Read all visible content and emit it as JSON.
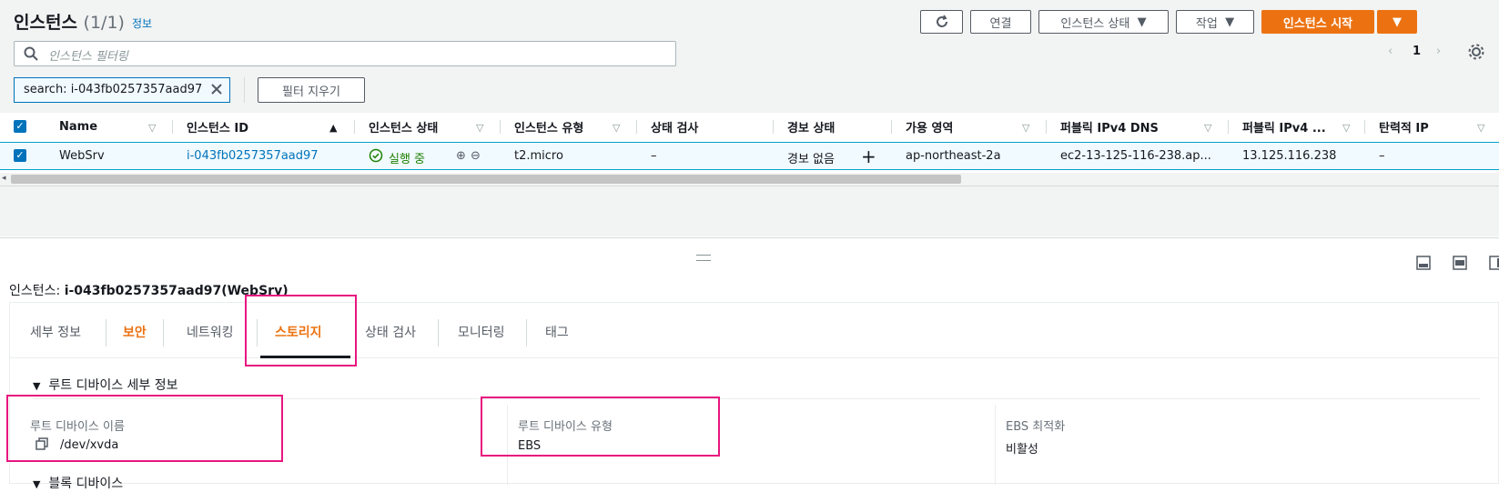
{
  "header": {
    "title": "인스턴스",
    "count": "(1/1)",
    "info_link": "정보",
    "refresh_icon": "refresh-icon",
    "connect_label": "연결",
    "instance_state_label": "인스턴스 상태",
    "actions_label": "작업",
    "launch_label": "인스턴스 시작"
  },
  "search": {
    "placeholder": "인스턴스 필터링"
  },
  "pager": {
    "current_page": "1"
  },
  "filter": {
    "token": "search: i-043fb0257357aad97",
    "clear_label": "필터 지우기"
  },
  "table": {
    "columns": [
      "Name",
      "인스턴스 ID",
      "인스턴스 상태",
      "인스턴스 유형",
      "상태 검사",
      "경보 상태",
      "가용 영역",
      "퍼블릭 IPv4 DNS",
      "퍼블릭 IPv4 ...",
      "탄력적 IP"
    ],
    "row": {
      "name": "WebSrv",
      "instance_id": "i-043fb0257357aad97",
      "state": "실행 중",
      "type": "t2.micro",
      "status_check": "–",
      "alarm": "경보 없음",
      "az": "ap-northeast-2a",
      "dns": "ec2-13-125-116-238.ap...",
      "ipv4": "13.125.116.238",
      "eip": "–"
    }
  },
  "detail": {
    "title_prefix": "인스턴스: ",
    "title_value": "i-043fb0257357aad97(WebSrv)",
    "tabs": [
      "세부 정보",
      "보안",
      "네트워킹",
      "스토리지",
      "상태 검사",
      "모니터링",
      "태그"
    ],
    "section_title": "루트 디바이스 세부 정보",
    "root_device_name_label": "루트 디바이스 이름",
    "root_device_name": "/dev/xvda",
    "root_device_type_label": "루트 디바이스 유형",
    "root_device_type": "EBS",
    "ebs_opt_label": "EBS 최적화",
    "ebs_opt_value": "비활성",
    "block_devices_label": "블록 디바이스"
  },
  "colors": {
    "accent": "#ec7211",
    "link": "#0073bb",
    "highlight": "#e8167f",
    "running": "#1d8102"
  }
}
